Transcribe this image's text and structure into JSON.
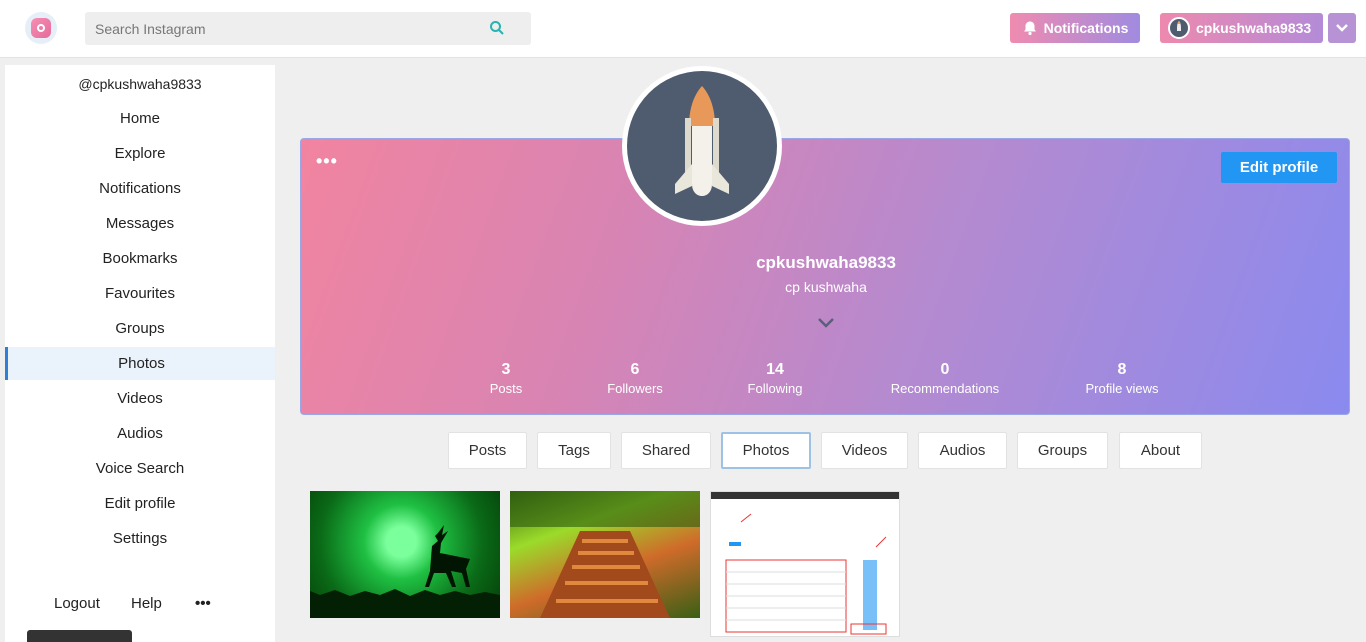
{
  "search": {
    "placeholder": "Search Instagram"
  },
  "header": {
    "notifications_label": "Notifications",
    "username": "cpkushwaha9833"
  },
  "sidebar": {
    "handle": "@cpkushwaha9833",
    "items": [
      {
        "label": "Home"
      },
      {
        "label": "Explore"
      },
      {
        "label": "Notifications"
      },
      {
        "label": "Messages"
      },
      {
        "label": "Bookmarks"
      },
      {
        "label": "Favourites"
      },
      {
        "label": "Groups"
      },
      {
        "label": "Photos"
      },
      {
        "label": "Videos"
      },
      {
        "label": "Audios"
      },
      {
        "label": "Voice Search"
      },
      {
        "label": "Edit profile"
      },
      {
        "label": "Settings"
      }
    ],
    "active": "Photos",
    "bottom": {
      "logout": "Logout",
      "help": "Help",
      "more": "•••"
    }
  },
  "profile": {
    "more": "•••",
    "edit_label": "Edit profile",
    "username": "cpkushwaha9833",
    "display_name": "cp kushwaha",
    "stats": [
      {
        "num": "3",
        "label": "Posts"
      },
      {
        "num": "6",
        "label": "Followers"
      },
      {
        "num": "14",
        "label": "Following"
      },
      {
        "num": "0",
        "label": "Recommendations"
      },
      {
        "num": "8",
        "label": "Profile views"
      }
    ]
  },
  "tabs": [
    {
      "label": "Posts"
    },
    {
      "label": "Tags"
    },
    {
      "label": "Shared"
    },
    {
      "label": "Photos"
    },
    {
      "label": "Videos"
    },
    {
      "label": "Audios"
    },
    {
      "label": "Groups"
    },
    {
      "label": "About"
    }
  ],
  "active_tab": "Photos",
  "colors": {
    "accent": "#2196f3",
    "active_border": "#2f7fd4"
  }
}
